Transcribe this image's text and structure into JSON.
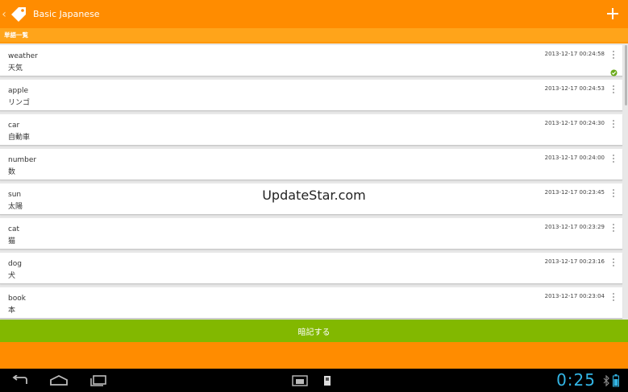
{
  "actionbar": {
    "title": "Basic Japanese"
  },
  "section": {
    "header": "単語一覧"
  },
  "words": [
    {
      "en": "weather",
      "ja": "天気",
      "timestamp": "2013-12-17 00:24:58",
      "checked": true
    },
    {
      "en": "apple",
      "ja": "リンゴ",
      "timestamp": "2013-12-17 00:24:53",
      "checked": false
    },
    {
      "en": "car",
      "ja": "自動車",
      "timestamp": "2013-12-17 00:24:30",
      "checked": false
    },
    {
      "en": "number",
      "ja": "数",
      "timestamp": "2013-12-17 00:24:00",
      "checked": false
    },
    {
      "en": "sun",
      "ja": "太陽",
      "timestamp": "2013-12-17 00:23:45",
      "checked": false
    },
    {
      "en": "cat",
      "ja": "猫",
      "timestamp": "2013-12-17 00:23:29",
      "checked": false
    },
    {
      "en": "dog",
      "ja": "犬",
      "timestamp": "2013-12-17 00:23:16",
      "checked": false
    },
    {
      "en": "book",
      "ja": "本",
      "timestamp": "2013-12-17 00:23:04",
      "checked": false
    }
  ],
  "watermark": "UpdateStar.com",
  "memorize_button": {
    "label": "暗記する"
  },
  "statusbar": {
    "time": "0:25"
  },
  "colors": {
    "actionbar": "#ff8c00",
    "section_header": "#ffa41a",
    "button": "#82b800",
    "clock": "#33b5e5"
  },
  "icons": {
    "up": "chevron-left-icon",
    "app": "tag-icon",
    "add": "plus-icon",
    "overflow": "vertical-dots-icon",
    "check": "check-circle-icon"
  }
}
